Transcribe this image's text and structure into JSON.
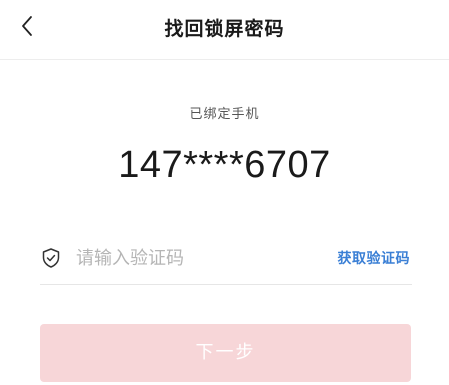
{
  "header": {
    "title": "找回锁屏密码",
    "back_icon": "chevron-left-icon"
  },
  "phone": {
    "label": "已绑定手机",
    "number": "147****6707"
  },
  "verification": {
    "icon": "shield-check-icon",
    "placeholder": "请输入验证码",
    "value": "",
    "get_code_label": "获取验证码"
  },
  "actions": {
    "next_label": "下一步",
    "next_enabled": false
  },
  "colors": {
    "accent_link": "#3a7fd5",
    "button_disabled_bg": "#f7d6d8",
    "button_text": "#ffffff"
  }
}
